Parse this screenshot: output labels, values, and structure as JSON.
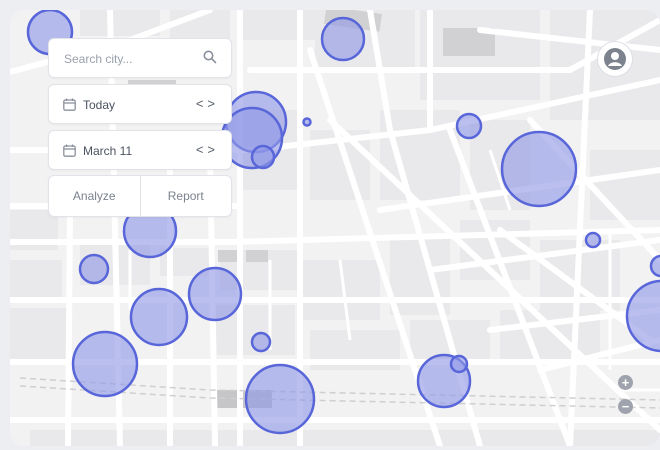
{
  "search": {
    "placeholder": "Search city..."
  },
  "date_filters": [
    {
      "label": "Today",
      "prev": "<",
      "next": ">"
    },
    {
      "label": "March 11",
      "prev": "<",
      "next": ">"
    }
  ],
  "actions": {
    "analyze": "Analyze",
    "report": "Report"
  },
  "zoom": {
    "in": "+",
    "out": "−"
  },
  "colors": {
    "bubble_fill": "#8f98e6",
    "bubble_stroke": "#5866d9",
    "road": "#ffffff",
    "block": "#ececee",
    "building": "#cfcfd1"
  },
  "icons": [
    "search-icon",
    "calendar-icon",
    "chevron-left-icon",
    "chevron-right-icon",
    "user-avatar-icon",
    "zoom-in-icon",
    "zoom-out-icon"
  ]
}
